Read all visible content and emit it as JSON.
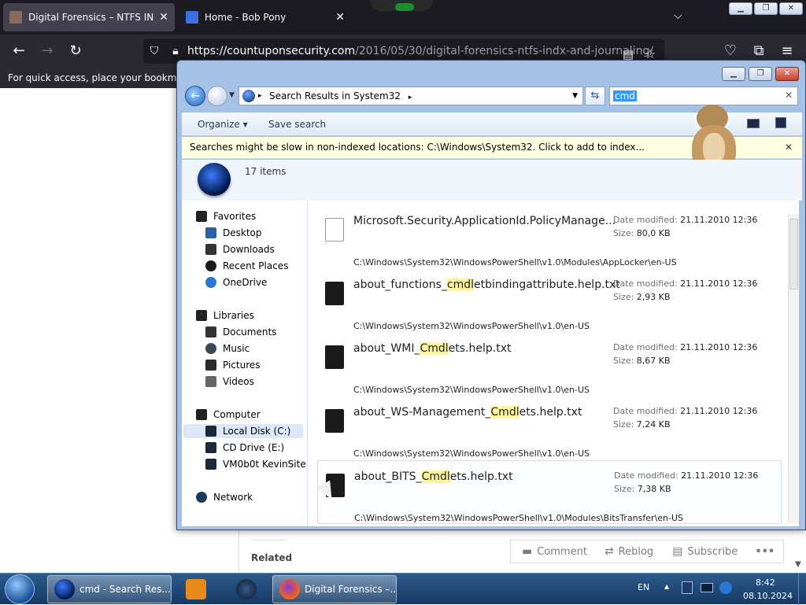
{
  "firefox": {
    "tabs": [
      {
        "title": "Digital Forensics – NTFS INDX a",
        "active": true
      },
      {
        "title": "Home - Bob Pony",
        "active": false
      }
    ],
    "url_host": "https://countuponsecurity.com",
    "url_path": "/2016/05/30/digital-forensics-ntfs-indx-and-journaling/",
    "bookmarks_hint": "For quick access, place your bookmarks l"
  },
  "page": {
    "related": "Related",
    "actions": [
      {
        "label": "Comment",
        "icon": "comment-icon"
      },
      {
        "label": "Reblog",
        "icon": "reblog-icon"
      },
      {
        "label": "Subscribe",
        "icon": "subscribe-icon"
      },
      {
        "label": "•••",
        "icon": "more-icon"
      }
    ]
  },
  "explorer": {
    "breadcrumb": "Search Results in System32",
    "search_term": "cmd",
    "toolbar": {
      "organize": "Organize ▾",
      "save_search": "Save search"
    },
    "info_bar": "Searches might be slow in non-indexed locations: C:\\Windows\\System32. Click to add to index...",
    "items_count": "17 items",
    "nav": {
      "favorites": "Favorites",
      "favorites_items": [
        "Desktop",
        "Downloads",
        "Recent Places",
        "OneDrive"
      ],
      "libraries": "Libraries",
      "libraries_items": [
        "Documents",
        "Music",
        "Pictures",
        "Videos"
      ],
      "computer": "Computer",
      "computer_items": [
        "Local Disk (C:)",
        "CD Drive (E:)",
        "VM0b0t KevinSite"
      ],
      "network": "Network"
    },
    "date_label": "Date modified:",
    "size_label": "Size:",
    "results": [
      {
        "pre": "Microsoft.Security.ApplicationId.PolicyManage...",
        "hl": "",
        "post": "",
        "date": "21.11.2010 12:36",
        "size": "80,0 KB",
        "path": "C:\\Windows\\System32\\WindowsPowerShell\\v1.0\\Modules\\AppLocker\\en-US",
        "xml": true
      },
      {
        "pre": "about_functions_",
        "hl": "cmdl",
        "post": "etbindingattribute.help.txt",
        "date": "21.11.2010 12:36",
        "size": "2,93 KB",
        "path": "C:\\Windows\\System32\\WindowsPowerShell\\v1.0\\en-US"
      },
      {
        "pre": "about_WMI_",
        "hl": "Cmdl",
        "post": "ets.help.txt",
        "date": "21.11.2010 12:36",
        "size": "8,67 KB",
        "path": "C:\\Windows\\System32\\WindowsPowerShell\\v1.0\\en-US"
      },
      {
        "pre": "about_WS-Management_",
        "hl": "Cmdl",
        "post": "ets.help.txt",
        "date": "21.11.2010 12:36",
        "size": "7,24 KB",
        "path": "C:\\Windows\\System32\\WindowsPowerShell\\v1.0\\en-US"
      },
      {
        "pre": "about_BITS_",
        "hl": "Cmdl",
        "post": "ets.help.txt",
        "date": "21.11.2010 12:36",
        "size": "7,38 KB",
        "path": "C:\\Windows\\System32\\WindowsPowerShell\\v1.0\\Modules\\BitsTransfer\\en-US"
      }
    ]
  },
  "taskbar": {
    "buttons": [
      {
        "label": "cmd - Search Res...",
        "icon": "explorer-icon"
      },
      {
        "label": "",
        "icon": "media-player-icon"
      },
      {
        "label": "",
        "icon": "app-icon"
      },
      {
        "label": "Digital Forensics –...",
        "icon": "firefox-icon"
      }
    ],
    "lang": "EN",
    "time": "8:42",
    "date": "08.10.2024"
  },
  "colors": {
    "accent": "#3399ff",
    "highlight": "#fff5a0",
    "taskbar": "#1f4a7a"
  }
}
